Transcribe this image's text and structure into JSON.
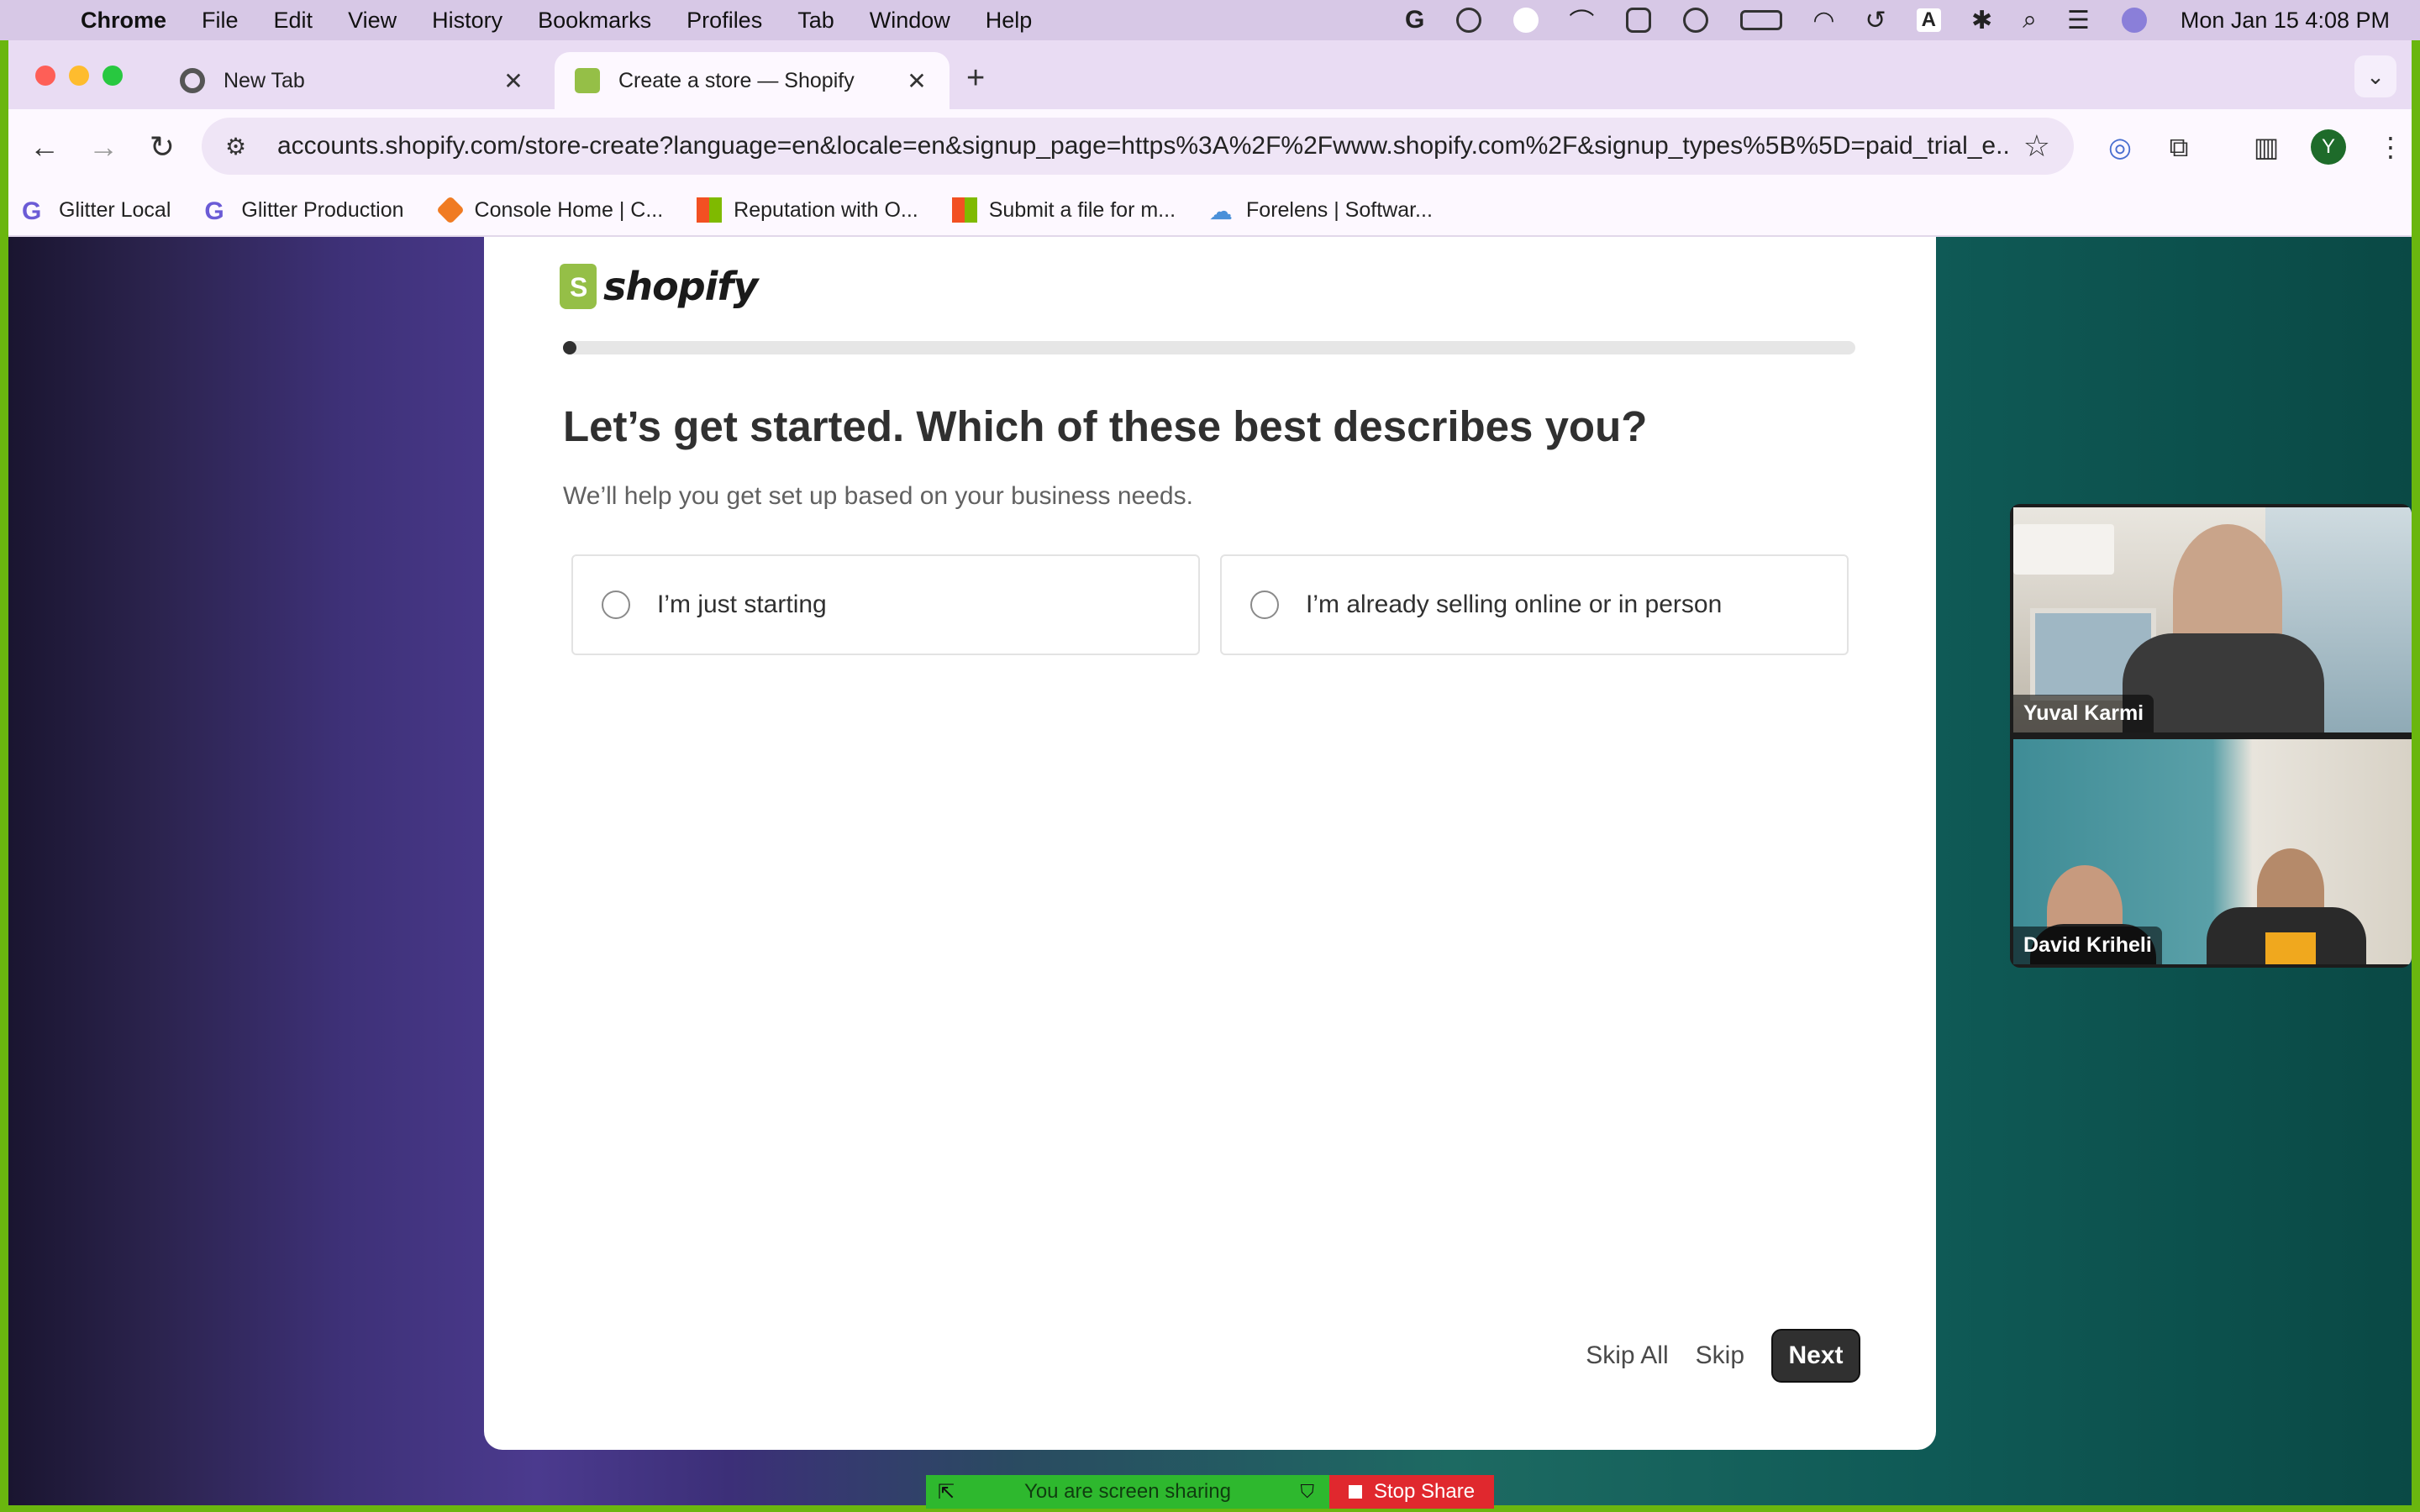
{
  "menubar": {
    "app_name": "Chrome",
    "items": [
      "File",
      "Edit",
      "View",
      "History",
      "Bookmarks",
      "Profiles",
      "Tab",
      "Window",
      "Help"
    ],
    "clock": "Mon Jan 15  4:08 PM"
  },
  "tabs": [
    {
      "label": "New Tab",
      "icon": "chrome-icon",
      "active": false
    },
    {
      "label": "Create a store — Shopify",
      "icon": "shopify-icon",
      "active": true
    }
  ],
  "address_bar": {
    "url": "accounts.shopify.com/store-create?language=en&locale=en&signup_page=https%3A%2F%2Fwww.shopify.com%2F&signup_types%5B%5D=paid_trial_e..."
  },
  "profile": {
    "initial": "Y"
  },
  "bookmarks": [
    {
      "label": "Glitter Local",
      "icon": "glitter-icon"
    },
    {
      "label": "Glitter Production",
      "icon": "glitter-icon"
    },
    {
      "label": "Console Home | C...",
      "icon": "cube-icon"
    },
    {
      "label": "Reputation with O...",
      "icon": "microsoft-icon"
    },
    {
      "label": "Submit a file for m...",
      "icon": "microsoft-icon"
    },
    {
      "label": "Forelens | Softwar...",
      "icon": "cloud-icon"
    }
  ],
  "page": {
    "brand": "shopify",
    "progress": 0.01,
    "heading": "Let’s get started. Which of these best describes you?",
    "subheading": "We’ll help you get set up based on your business needs.",
    "options": [
      {
        "label": "I’m just starting",
        "selected": false
      },
      {
        "label": "I’m already selling online or in person",
        "selected": false
      }
    ],
    "buttons": {
      "skip_all": "Skip All",
      "skip": "Skip",
      "next": "Next"
    }
  },
  "video": {
    "participants": [
      "Yuval Karmi",
      "David Kriheli"
    ]
  },
  "screen_share": {
    "status": "You are screen sharing",
    "stop": "Stop Share"
  },
  "colors": {
    "accent": "#303030",
    "shopify_green": "#95bf47",
    "share_green": "#2eb82e",
    "stop_red": "#e0282e"
  }
}
